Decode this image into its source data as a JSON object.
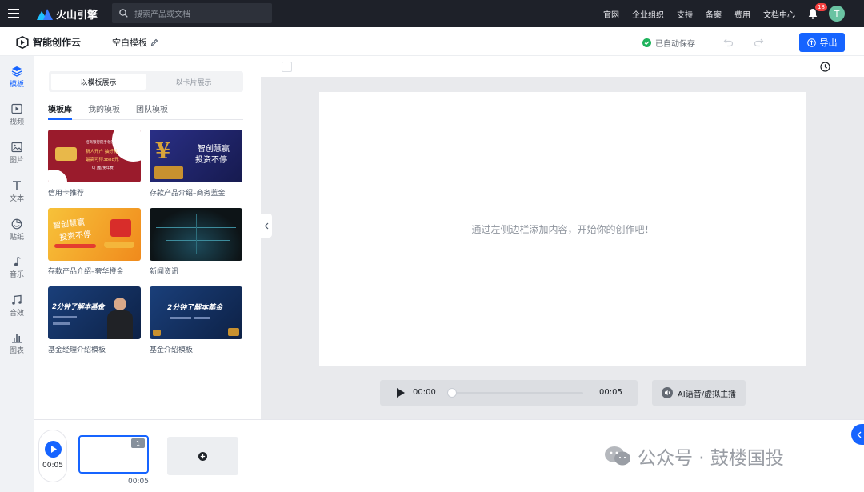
{
  "topnav": {
    "brand": "火山引擎",
    "search_placeholder": "搜索产品或文档",
    "links": [
      "官网",
      "企业组织",
      "支持",
      "备案",
      "费用",
      "文档中心"
    ],
    "notification_count": "18",
    "avatar_letter": "T"
  },
  "header": {
    "app_name": "智能创作云",
    "doc_title": "空白模板",
    "autosave": "已自动保存",
    "export_label": "导出"
  },
  "rail": {
    "items": [
      {
        "label": "模板",
        "icon": "template-icon",
        "active": true
      },
      {
        "label": "视频",
        "icon": "video-icon",
        "active": false
      },
      {
        "label": "图片",
        "icon": "image-icon",
        "active": false
      },
      {
        "label": "文本",
        "icon": "text-icon",
        "active": false
      },
      {
        "label": "贴纸",
        "icon": "sticker-icon",
        "active": false
      },
      {
        "label": "音乐",
        "icon": "music-icon",
        "active": false
      },
      {
        "label": "音效",
        "icon": "sound-effect-icon",
        "active": false
      },
      {
        "label": "图表",
        "icon": "chart-icon",
        "active": false
      }
    ]
  },
  "panel": {
    "view_toggle": [
      "以模板展示",
      "以卡片展示"
    ],
    "tabs": [
      "模板库",
      "我的模板",
      "团队模板"
    ],
    "templates": [
      {
        "label": "信用卡推荐",
        "thumb_lines": [
          "招商银行随手领卷",
          "新人开户 抽好礼",
          "最高可得3888元",
          "0门槛  免年费"
        ]
      },
      {
        "label": "存款产品介绍–商务蓝金",
        "thumb_lines": [
          "智创慧赢",
          "投资不停"
        ]
      },
      {
        "label": "存款产品介绍–奢华橙金",
        "thumb_lines": [
          "智创慧赢",
          "投资不停"
        ]
      },
      {
        "label": "新闻资讯",
        "thumb_lines": []
      },
      {
        "label": "基金经理介绍模板",
        "thumb_lines": [
          "2分钟了解本基金"
        ]
      },
      {
        "label": "基金介绍模板",
        "thumb_lines": [
          "2分钟了解本基金"
        ]
      }
    ]
  },
  "canvas": {
    "hint": "通过左侧边栏添加内容，开始你的创作吧！",
    "time_current": "00:00",
    "time_total": "00:05",
    "progress": 0,
    "ai_button": "AI语音/虚拟主播"
  },
  "timeline": {
    "total_time": "00:05",
    "scene_number": "1",
    "scene_duration": "00:05"
  },
  "watermark": {
    "text": "公众号 · 鼓楼国投"
  },
  "colors": {
    "accent": "#1664ff",
    "nav_bg": "#1e2129",
    "canvas_bg": "#e9eaed"
  }
}
